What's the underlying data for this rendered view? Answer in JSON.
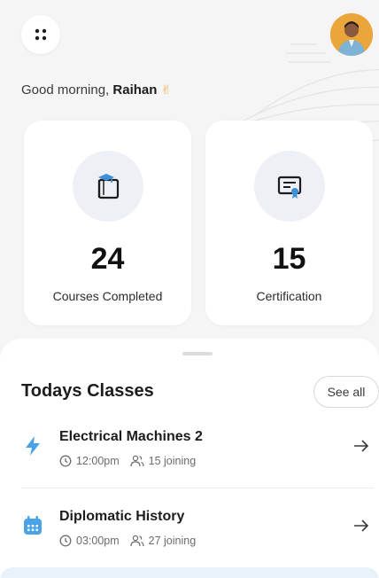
{
  "greeting": {
    "prefix": "Good morning, ",
    "name": "Raihan",
    "emoji": "✌"
  },
  "stats": [
    {
      "value": "24",
      "label": "Courses Completed",
      "icon": "book-icon"
    },
    {
      "value": "15",
      "label": "Certification",
      "icon": "certificate-icon"
    }
  ],
  "classes": {
    "title": "Todays Classes",
    "see_all": "See all",
    "items": [
      {
        "name": "Electrical Machines 2",
        "time": "12:00pm",
        "joining": "15 joining",
        "icon": "lightning-icon",
        "icon_color": "#4aa3e6"
      },
      {
        "name": "Diplomatic History",
        "time": "03:00pm",
        "joining": "27 joining",
        "icon": "calendar-icon",
        "icon_color": "#4aa3e6"
      }
    ]
  },
  "colors": {
    "accent": "#4aa3e6",
    "background": "#f5f5f6",
    "card": "#ffffff"
  }
}
